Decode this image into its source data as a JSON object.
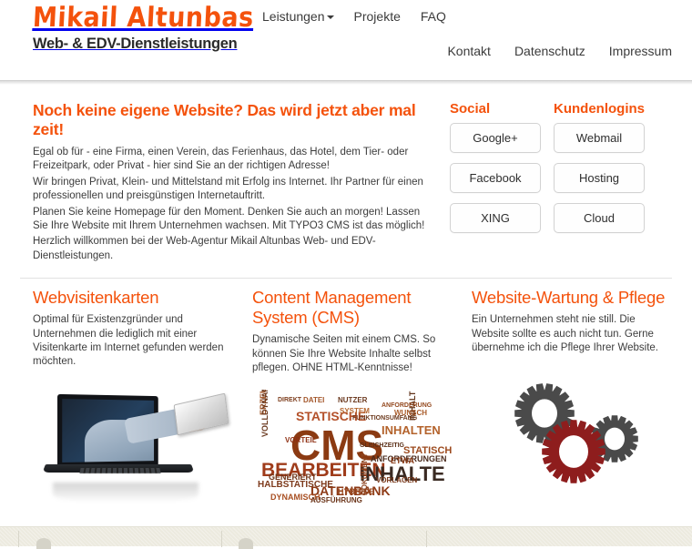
{
  "header": {
    "brand_name": "Mikail Altunbas",
    "brand_sub": "Web- & EDV-Dienstleistungen",
    "nav_top": [
      {
        "label": "Leistungen",
        "has_caret": true
      },
      {
        "label": "Projekte",
        "has_caret": false
      },
      {
        "label": "FAQ",
        "has_caret": false
      }
    ],
    "nav_bottom": [
      {
        "label": "Kontakt"
      },
      {
        "label": "Datenschutz"
      },
      {
        "label": "Impressum"
      }
    ]
  },
  "intro": {
    "title": "Noch keine eigene Website? Das wird jetzt aber mal zeit!",
    "paragraphs": [
      "Egal ob für - eine Firma, einen Verein, das Ferienhaus, das Hotel, dem Tier- oder Freizeitpark, oder Privat - hier sind Sie an der richtigen Adresse!",
      "Wir bringen Privat, Klein- und Mittelstand mit Erfolg ins Internet. Ihr Partner für einen professionellen und preisgünstigen Internetauftritt.",
      "Planen Sie keine Homepage für den Moment. Denken Sie auch an morgen! Lassen Sie Ihre Website mit Ihrem Unternehmen wachsen. Mit TYPO3 CMS ist das möglich!",
      "Herzlich willkommen bei der Web-Agentur Mikail Altunbas Web- und EDV-Dienstleistungen."
    ]
  },
  "social": {
    "heading": "Social",
    "buttons": [
      "Google+",
      "Facebook",
      "XING"
    ]
  },
  "kundenlogins": {
    "heading": "Kundenlogins",
    "buttons": [
      "Webmail",
      "Hosting",
      "Cloud"
    ]
  },
  "columns": [
    {
      "title": "Webvisitenkarten",
      "body": "Optimal für Existenzgründer und Unternehmen die lediglich mit einer Visitenkarte im Internet gefunden werden möchten.",
      "image_alt": "laptop-with-hand-holding-business-card"
    },
    {
      "title": "Content Management System (CMS)",
      "body": "Dynamische Seiten mit einem CMS. So können Sie Ihre Website Inhalte selbst pflegen. OHNE HTML-Kenntnisse!",
      "image_alt": "cms-word-cloud"
    },
    {
      "title": "Website-Wartung & Pflege",
      "body": "Ein Unternehmen steht nie still. Die Website sollte es auch nicht tun. Gerne übernehme ich die Pflege Ihrer Website.",
      "image_alt": "three-gears"
    }
  ],
  "word_cloud": {
    "words": [
      "CMS",
      "BEARBEITEN",
      "INHALTE",
      "STATISCHE",
      "DATENBANK",
      "INHALTEN",
      "ERZEUGEN",
      "VOLLDYNAMISCHE",
      "HALBSTATISCHE",
      "DYNAMISCH",
      "GENERIERT",
      "STATISCH",
      "ANFORDERUNGEN",
      "ETWA",
      "INHALT",
      "SYSTEM",
      "VORLAGEN",
      "HYBRIDE",
      "AUSFÜHRUNG",
      "DOKUMENT",
      "DATEI",
      "VORTEIL",
      "NUTZER",
      "WUNSCH",
      "DIREKT",
      "GLEICHZEITIG",
      "ANFORDERUNG",
      "FUNKTIONSUMFANG"
    ]
  },
  "colors": {
    "accent_orange": "#f4520c",
    "text_dark": "#3c3c3c",
    "button_border": "#d2d2d2",
    "footer_bg": "#eceadf",
    "gear_red": "#8e1d1d",
    "gear_gray": "#4a4a4a"
  }
}
